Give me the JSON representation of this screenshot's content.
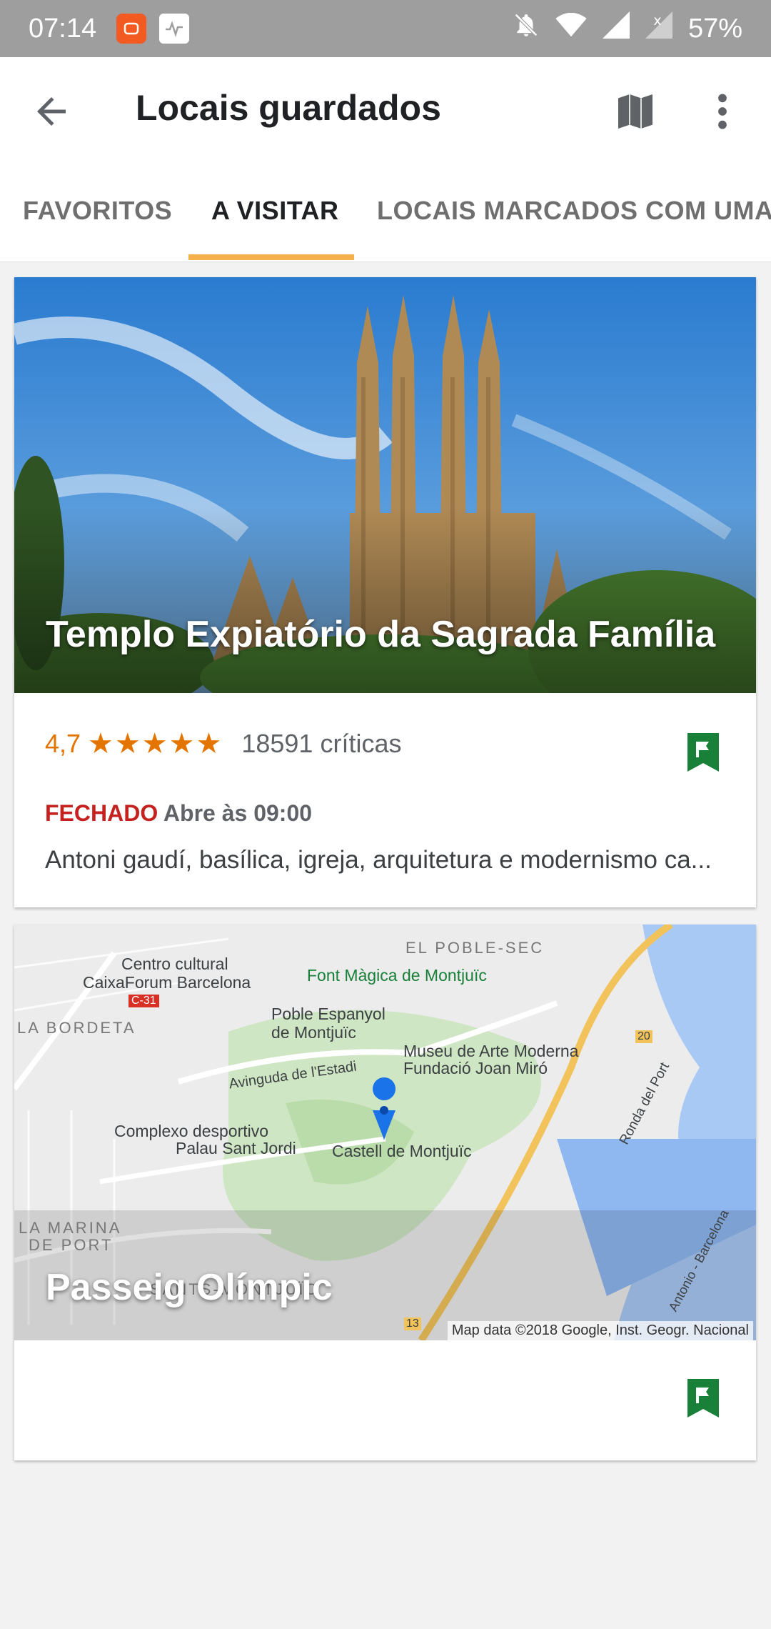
{
  "status_bar": {
    "time": "07:14",
    "battery": "57%",
    "icons": [
      "notifications-off-icon",
      "wifi-icon",
      "signal-icon",
      "signal-x-icon"
    ]
  },
  "app_bar": {
    "title": "Locais guardados",
    "icons": [
      "back-arrow-icon",
      "map-icon",
      "more-vert-icon"
    ]
  },
  "tabs": [
    {
      "label": "FAVORITOS",
      "active": false
    },
    {
      "label": "A VISITAR",
      "active": true
    },
    {
      "label": "LOCAIS MARCADOS COM UMA E",
      "active": false
    }
  ],
  "accent_color": "#f4b04a",
  "cards": [
    {
      "title": "Templo Expiatório da Sagrada Família",
      "rating": "4,7",
      "stars": "★★★★★",
      "reviews": "18591 críticas",
      "status_closed": "FECHADO",
      "status_opens": "Abre às 09:00",
      "description": "Antoni gaudí, basílica, igreja, arquitetura e modernismo ca...",
      "bookmark_color": "#188038"
    },
    {
      "title": "Passeig Olímpic",
      "map_credit": "Map data ©2018 Google, Inst. Geogr. Nacional",
      "map_labels": [
        "EL POBLE-SEC",
        "Centro cultural",
        "CaixaForum Barcelona",
        "Font Màgica de Montjuïc",
        "C-31",
        "LA BORDETA",
        "Poble Espanyol",
        "de Montjuïc",
        "Museu de Arte Moderna",
        "Fundació Joan Miró",
        "Avinguda de l'Estadi",
        "Complexo desportivo",
        "Palau Sant Jordi",
        "Castell de Montjuïc",
        "Ronda del Port",
        "LA MARINA",
        "DE PORT",
        "SANTS-MONTJUÏC",
        "Antonio - Barcelona",
        "20",
        "13"
      ],
      "bookmark_color": "#188038"
    }
  ]
}
